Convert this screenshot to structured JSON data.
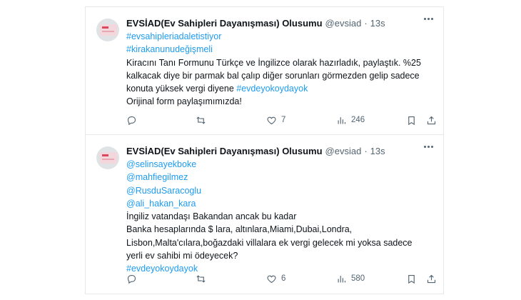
{
  "tweets": [
    {
      "name": "EVSİAD(Ev Sahipleri Dayanışması) Olusumu",
      "handle": "@evsiad",
      "dot": "·",
      "time": "13s",
      "lines": [
        {
          "text": "#evsahipleriadaletistiyor",
          "link": true
        },
        {
          "text": " #kirakanunudeğişmeli",
          "link": true
        },
        {
          "text": "Kiracını Tanı Formunu Türkçe ve İngilizce olarak hazırladık, paylaştık. %25",
          "link": false
        },
        {
          "text": "kalkacak diye bir parmak bal çalıp  diğer sorunları görmezden gelip sadece",
          "link": false
        },
        {
          "text_parts": [
            {
              "text": "konuta yüksek vergi diyene ",
              "link": false
            },
            {
              "text": "#evdeyokoydayok",
              "link": true
            }
          ]
        },
        {
          "text": "Orijinal form paylaşımımızda!",
          "link": false
        }
      ],
      "replies": "",
      "retweets": "",
      "likes": "7",
      "views": "246"
    },
    {
      "name": "EVSİAD(Ev Sahipleri Dayanışması) Olusumu",
      "handle": "@evsiad",
      "dot": "·",
      "time": "13s",
      "lines": [
        {
          "text": "@selinsayekboke",
          "link": true
        },
        {
          "text": "@mahfiegilmez",
          "link": true
        },
        {
          "text": "@RusduSaracoglu",
          "link": true
        },
        {
          "text": "@ali_hakan_kara",
          "link": true
        },
        {
          "text": "İngiliz vatandaşı Bakandan ancak bu kadar",
          "link": false
        },
        {
          "text": "Banka hesaplarında $ lara, altınlara,Miami,Dubai,Londra,",
          "link": false
        },
        {
          "text": "Lisbon,Malta'cılara,boğazdaki villalara ek vergi gelecek mi yoksa sadece",
          "link": false
        },
        {
          "text": "yerli ev sahibi mi ödeyecek?",
          "link": false
        },
        {
          "text": "#evdeyokoydayok",
          "link": true
        }
      ],
      "replies": "",
      "retweets": "",
      "likes": "6",
      "views": "580"
    }
  ],
  "icons": {
    "reply": "reply-icon",
    "retweet": "retweet-icon",
    "like": "heart-icon",
    "views": "views-icon",
    "bookmark": "bookmark-icon",
    "share": "share-icon",
    "more": "more-icon"
  },
  "colors": {
    "link": "#1d9bf0",
    "muted": "#536471",
    "text": "#0f1419"
  }
}
